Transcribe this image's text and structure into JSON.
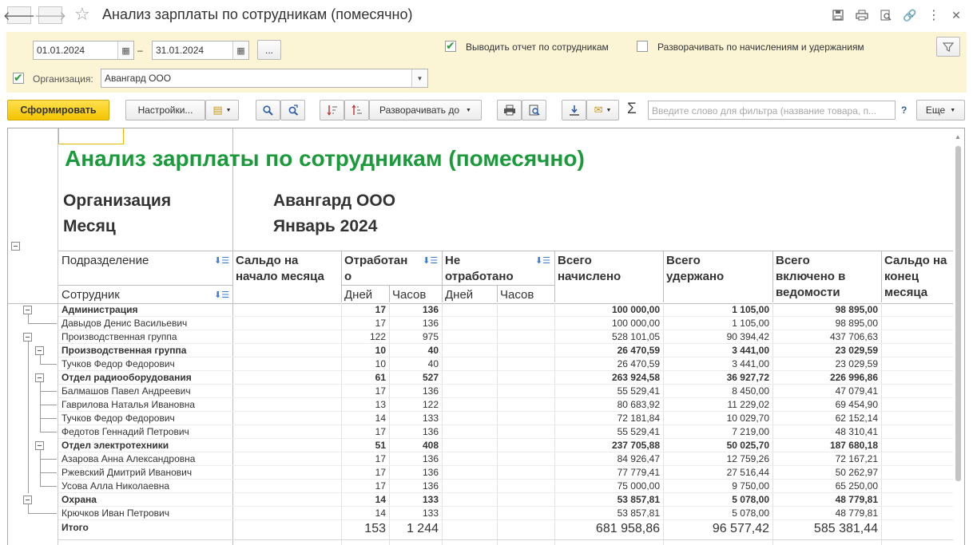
{
  "window": {
    "title": "Анализ зарплаты по сотрудникам (помесячно)"
  },
  "params": {
    "date_from": "01.01.2024",
    "date_to": "31.01.2024",
    "dash": "–",
    "more_label": "...",
    "show_by_employee_label": "Выводить отчет по сотрудникам",
    "show_by_employee": true,
    "expand_label": "Разворачивать по начислениям и удержаниям",
    "expand": false,
    "org_label": "Организация:",
    "org_checked": true,
    "org_value": "Авангард ООО"
  },
  "toolbar": {
    "generate_label": "Сформировать",
    "settings_label": "Настройки...",
    "expand_to_label": "Разворачивать до",
    "sigma": "Σ",
    "filter_placeholder": "Введите слово для фильтра (название товара, п...",
    "help": "?",
    "more_label": "Еще"
  },
  "report": {
    "title": "Анализ зарплаты по сотрудникам (помесячно)",
    "org_label": "Организация",
    "org_value": "Авангард ООО",
    "month_label": "Месяц",
    "month_value": "Январь 2024",
    "headers": {
      "division": "Подразделение",
      "employee": "Сотрудник",
      "balance_start": [
        "Сальдо на",
        "начало месяца"
      ],
      "worked": [
        "Отработан",
        "о"
      ],
      "not_worked": [
        "Не",
        "отработано"
      ],
      "days": "Дней",
      "hours": "Часов",
      "accrued": [
        "Всего",
        "начислено"
      ],
      "withheld": [
        "Всего",
        "удержано"
      ],
      "included": [
        "Всего",
        "включено в",
        "ведомости"
      ],
      "balance_end": [
        "Сальдо на",
        "конец месяца"
      ]
    },
    "rows": [
      {
        "name": "Администрация",
        "days": "17",
        "hours": "136",
        "accrued": "100 000,00",
        "withheld": "1 105,00",
        "included": "98 895,00",
        "bold": true
      },
      {
        "name": "Давыдов Денис Васильевич",
        "days": "17",
        "hours": "136",
        "accrued": "100 000,00",
        "withheld": "1 105,00",
        "included": "98 895,00",
        "bold": false
      },
      {
        "name": "Производственная группа",
        "days": "122",
        "hours": "975",
        "accrued": "528 101,05",
        "withheld": "90 394,42",
        "included": "437 706,63",
        "bold": false
      },
      {
        "name": "Производственная группа",
        "days": "10",
        "hours": "40",
        "accrued": "26 470,59",
        "withheld": "3 441,00",
        "included": "23 029,59",
        "bold": true
      },
      {
        "name": "Тучков Федор Федорович",
        "days": "10",
        "hours": "40",
        "accrued": "26 470,59",
        "withheld": "3 441,00",
        "included": "23 029,59",
        "bold": false
      },
      {
        "name": "Отдел радиооборудования",
        "days": "61",
        "hours": "527",
        "accrued": "263 924,58",
        "withheld": "36 927,72",
        "included": "226 996,86",
        "bold": true
      },
      {
        "name": "Балмашов Павел Андреевич",
        "days": "17",
        "hours": "136",
        "accrued": "55 529,41",
        "withheld": "8 450,00",
        "included": "47 079,41",
        "bold": false
      },
      {
        "name": "Гаврилова Наталья Ивановна",
        "days": "13",
        "hours": "122",
        "accrued": "80 683,92",
        "withheld": "11 229,02",
        "included": "69 454,90",
        "bold": false
      },
      {
        "name": "Тучков Федор Федорович",
        "days": "14",
        "hours": "133",
        "accrued": "72 181,84",
        "withheld": "10 029,70",
        "included": "62 152,14",
        "bold": false
      },
      {
        "name": "Федотов Геннадий Петрович",
        "days": "17",
        "hours": "136",
        "accrued": "55 529,41",
        "withheld": "7 219,00",
        "included": "48 310,41",
        "bold": false
      },
      {
        "name": "Отдел электротехники",
        "days": "51",
        "hours": "408",
        "accrued": "237 705,88",
        "withheld": "50 025,70",
        "included": "187 680,18",
        "bold": true
      },
      {
        "name": "Азарова Анна Александровна",
        "days": "17",
        "hours": "136",
        "accrued": "84 926,47",
        "withheld": "12 759,26",
        "included": "72 167,21",
        "bold": false
      },
      {
        "name": "Ржевский Дмитрий Иванович",
        "days": "17",
        "hours": "136",
        "accrued": "77 779,41",
        "withheld": "27 516,44",
        "included": "50 262,97",
        "bold": false
      },
      {
        "name": "Усова Алла Николаевна",
        "days": "17",
        "hours": "136",
        "accrued": "75 000,00",
        "withheld": "9 750,00",
        "included": "65 250,00",
        "bold": false
      },
      {
        "name": "Охрана",
        "days": "14",
        "hours": "133",
        "accrued": "53 857,81",
        "withheld": "5 078,00",
        "included": "48 779,81",
        "bold": true
      },
      {
        "name": "Крючков Иван Петрович",
        "days": "14",
        "hours": "133",
        "accrued": "53 857,81",
        "withheld": "5 078,00",
        "included": "48 779,81",
        "bold": false
      }
    ],
    "total": {
      "name": "Итого",
      "days": "153",
      "hours": "1 244",
      "accrued": "681 958,86",
      "withheld": "96 577,42",
      "included": "585 381,44"
    }
  }
}
